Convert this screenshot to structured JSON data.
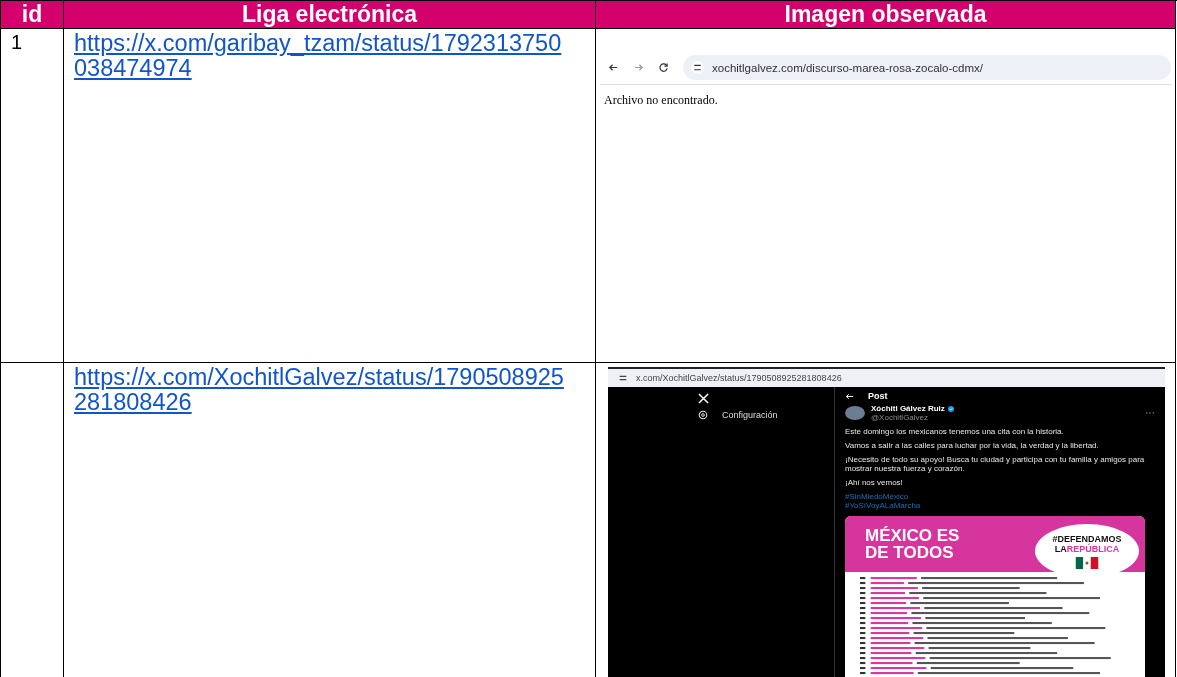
{
  "table": {
    "columns": [
      "id",
      "Liga electrónica",
      "Imagen observada"
    ],
    "rows": [
      {
        "id": "1",
        "link": "https://x.com/garibay_tzam/status/1792313750038474974",
        "image": {
          "kind": "browser",
          "url": "xochitlgalvez.com/discurso-marea-rosa-zocalo-cdmx/",
          "body": "Archivo no encontrado."
        }
      },
      {
        "link": "https://x.com/XochitlGalvez/status/1790508925281808426",
        "image": {
          "kind": "tweet",
          "url": "x.com/XochitlGalvez/status/1790508925281808426",
          "nav_item": "Configuración",
          "header": "Post",
          "author": "Xóchitl Gálvez Ruiz",
          "handle": "@XochitlGalvez",
          "paragraphs": [
            "Este domingo los mexicanos tenemos una cita con la historia.",
            "Vamos a salir a las calles para luchar por la vida, la verdad y la libertad.",
            "¡Necesito de todo su apoyo! Busca tu ciudad y participa con tu familia y amigos para mostrar nuestra fuerza y corazón.",
            "¡Ahí nos vemos!"
          ],
          "hashtags": [
            "#SinMiedoMéxico",
            "#YoSíVoyALaMarcha"
          ],
          "poster": {
            "title_lines": [
              "MÉXICO ES",
              "DE TODOS"
            ],
            "badge_top": "#DEFENDAMOS",
            "badge_bottom": [
              "LA",
              "REPÚBLICA"
            ]
          }
        }
      }
    ]
  }
}
